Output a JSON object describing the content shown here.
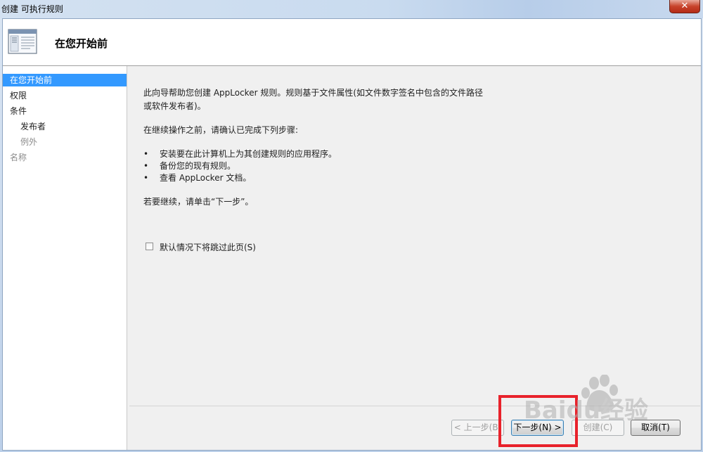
{
  "window": {
    "title": "创建 可执行规则",
    "close_glyph": "✕"
  },
  "header": {
    "title": "在您开始前"
  },
  "sidebar": {
    "items": [
      {
        "label": "在您开始前",
        "state": "active",
        "level": 0
      },
      {
        "label": "权限",
        "state": "normal",
        "level": 0
      },
      {
        "label": "条件",
        "state": "normal",
        "level": 0
      },
      {
        "label": "发布者",
        "state": "normal",
        "level": 1
      },
      {
        "label": "例外",
        "state": "disabled",
        "level": 1
      },
      {
        "label": "名称",
        "state": "disabled",
        "level": 0
      }
    ]
  },
  "content": {
    "intro_line1": "此向导帮助您创建 AppLocker 规则。规则基于文件属性(如文件数字签名中包含的文件路径",
    "intro_line2": "或软件发布者)。",
    "before_text": "在继续操作之前，请确认已完成下列步骤:",
    "bullet_glyph": "•",
    "bullets": [
      "安装要在此计算机上为其创建规则的应用程序。",
      "备份您的现有规则。",
      "查看 AppLocker 文档。"
    ],
    "continue_text": "若要继续，请单击“下一步”。",
    "skip_checkbox_label": "默认情况下将跳过此页(S)",
    "skip_checkbox_checked": false
  },
  "buttons": {
    "back": "< 上一步(B)",
    "next": "下一步(N) >",
    "create": "创建(C)",
    "cancel": "取消(T)"
  },
  "watermark": {
    "text": "Baidu经验"
  },
  "colors": {
    "accent_selected": "#3399ff",
    "highlight_box": "#e8222b",
    "close_button": "#c7432b"
  }
}
